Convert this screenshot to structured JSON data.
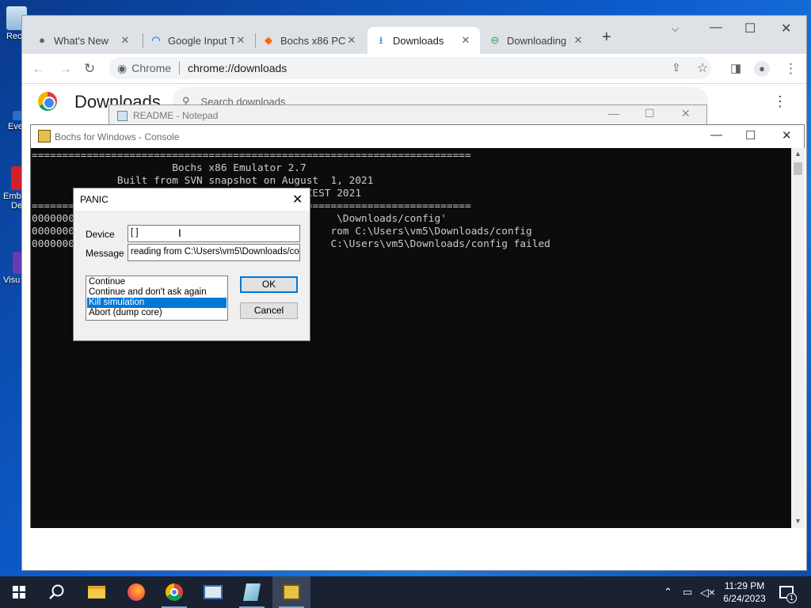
{
  "desktop": {
    "icons": [
      {
        "label": "Rec",
        "icon": "recycle-bin-icon"
      },
      {
        "label": "Eve",
        "icon": "shortcut-icon"
      },
      {
        "label": "Emb",
        "label2": "De",
        "icon": "app-icon"
      },
      {
        "label": "Visu",
        "icon": "shortcut-icon"
      }
    ]
  },
  "chrome": {
    "tabs": [
      {
        "title": "What's New",
        "icon": "chrome-icon"
      },
      {
        "title": "Google Input T",
        "icon": "google-icon"
      },
      {
        "title": "Bochs x86 PC",
        "icon": "sourceforge-icon"
      },
      {
        "title": "Downloads",
        "icon": "download-icon",
        "active": true
      },
      {
        "title": "Downloading",
        "icon": "download-site-icon"
      }
    ],
    "omnibox": {
      "site_chip": "Chrome",
      "url": "chrome://downloads"
    },
    "page": {
      "title": "Downloads",
      "search_placeholder": "Search downloads"
    }
  },
  "notepad": {
    "title": "README - Notepad"
  },
  "bochs": {
    "title": "Bochs for Windows - Console",
    "console_lines": [
      "========================================================================",
      "                       Bochs x86 Emulator 2.7",
      "              Built from SVN snapshot on August  1, 2021",
      "                                          00 CEST 2021",
      "========================================================================",
      "00000000                                          \\Downloads/config'",
      "00000000                                         rom C:\\Users\\vm5\\Downloads/config",
      "00000000                                         C:\\Users\\vm5\\Downloads/config failed"
    ]
  },
  "panic": {
    "title": "PANIC",
    "device_label": "Device",
    "device_value": "[    ]",
    "message_label": "Message",
    "message_value": "reading from C:\\Users\\vm5\\Downloads/config",
    "options": [
      {
        "label": "Continue",
        "selected": false
      },
      {
        "label": "Continue and don't ask again",
        "selected": false
      },
      {
        "label": "Kill simulation",
        "selected": true
      },
      {
        "label": "Abort (dump core)",
        "selected": false
      }
    ],
    "ok_label": "OK",
    "cancel_label": "Cancel"
  },
  "taskbar": {
    "apps": [
      "start-icon",
      "search-icon",
      "file-explorer-icon",
      "firefox-icon",
      "chrome-icon",
      "remote-desktop-icon",
      "notepad-icon",
      "bochs-icon"
    ],
    "time": "11:29 PM",
    "date": "6/24/2023",
    "notification_count": "1"
  }
}
